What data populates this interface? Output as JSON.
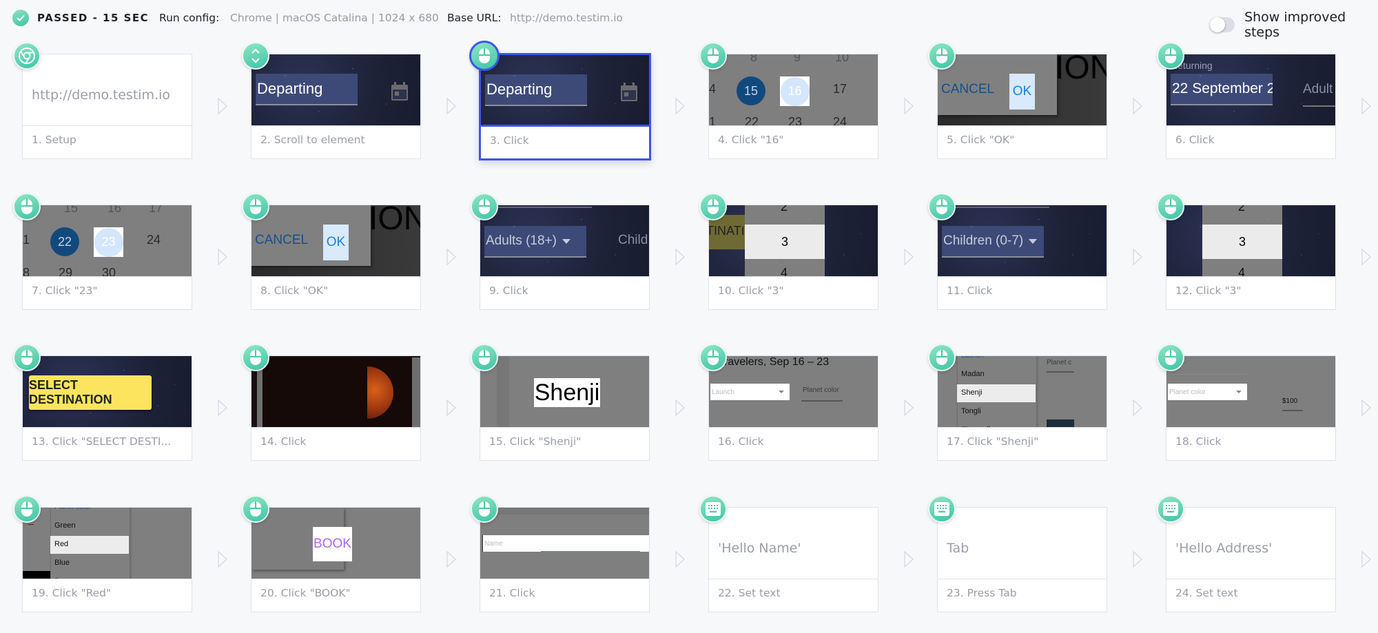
{
  "header": {
    "status": "PASSED - 15 SEC",
    "status_icon": "check-icon",
    "run_config_label": "Run config:",
    "run_config_value": "Chrome | macOS Catalina | 1024 x 680",
    "base_url_label": "Base URL:",
    "base_url_value": "http://demo.testim.io",
    "toggle_label": "Show improved steps",
    "toggle_on": false
  },
  "colors": {
    "accent_selected": "#3d54f0",
    "badge_green": "#3ec4a6",
    "caption_gray": "#9b9dab",
    "background": "#f7f8fa"
  },
  "steps": [
    {
      "caption": "1. Setup",
      "icon": "chrome-icon",
      "thumb": {
        "kind": "text",
        "text": "http://demo.testim.io"
      }
    },
    {
      "caption": "2. Scroll to element",
      "icon": "scroll-icon",
      "thumb": {
        "kind": "departing",
        "text": "Departing"
      }
    },
    {
      "caption": "3. Click",
      "icon": "mouse-icon",
      "selected": true,
      "thumb": {
        "kind": "departing",
        "text": "Departing"
      }
    },
    {
      "caption": "4. Click \"16\"",
      "icon": "mouse-icon",
      "thumb": {
        "kind": "calendar",
        "top": [
          "8",
          "9",
          "10"
        ],
        "left_edge": "4",
        "selected": "15",
        "target": "16",
        "next": "17",
        "bottom": [
          "1",
          "22",
          "23",
          "24"
        ]
      }
    },
    {
      "caption": "5. Click \"OK\"",
      "icon": "mouse-icon",
      "thumb": {
        "kind": "dialog",
        "cancel": "CANCEL",
        "ok": "OK",
        "bg_text": "ION"
      }
    },
    {
      "caption": "6. Click",
      "icon": "mouse-icon",
      "thumb": {
        "kind": "returning",
        "label": "Returning",
        "text": "22 September 2",
        "side": "Adult"
      }
    },
    {
      "caption": "7. Click \"23\"",
      "icon": "mouse-icon",
      "thumb": {
        "kind": "calendar",
        "top": [
          "15",
          "16",
          "17"
        ],
        "left_edge": "1",
        "selected": "22",
        "target": "23",
        "next": "24",
        "bottom": [
          "8",
          "29",
          "30",
          ""
        ]
      }
    },
    {
      "caption": "8. Click \"OK\"",
      "icon": "mouse-icon",
      "thumb": {
        "kind": "dialog",
        "cancel": "CANCEL",
        "ok": "OK",
        "bg_text": "ION"
      }
    },
    {
      "caption": "9. Click",
      "icon": "mouse-icon",
      "thumb": {
        "kind": "dropdown-field",
        "text": "Adults (18+)",
        "side": "Child"
      }
    },
    {
      "caption": "10. Click \"3\"",
      "icon": "mouse-icon",
      "thumb": {
        "kind": "picker",
        "above": "2",
        "value": "3",
        "below": "4",
        "side": "TINATI"
      }
    },
    {
      "caption": "11. Click",
      "icon": "mouse-icon",
      "thumb": {
        "kind": "dropdown-field",
        "text": "Children (0-7)",
        "side": ""
      }
    },
    {
      "caption": "12. Click \"3\"",
      "icon": "mouse-icon",
      "thumb": {
        "kind": "picker",
        "above": "2",
        "value": "3",
        "below": "4",
        "side": ""
      }
    },
    {
      "caption": "13. Click \"SELECT DESTI...",
      "icon": "mouse-icon",
      "thumb": {
        "kind": "yellow-button",
        "text": "SELECT DESTINATION"
      }
    },
    {
      "caption": "14. Click",
      "icon": "mouse-icon",
      "thumb": {
        "kind": "moon"
      }
    },
    {
      "caption": "15. Click \"Shenji\"",
      "icon": "mouse-icon",
      "thumb": {
        "kind": "big-word",
        "text": "Shenji"
      }
    },
    {
      "caption": "16. Click",
      "icon": "mouse-icon",
      "thumb": {
        "kind": "travelers",
        "title": "ravelers, Sep 16 – 23",
        "select": "Launch",
        "side": "Planet color"
      }
    },
    {
      "caption": "17. Click \"Shenji\"",
      "icon": "mouse-icon",
      "thumb": {
        "kind": "list",
        "header": "Launch",
        "items": [
          "Madan",
          "Shenji",
          "Tongli",
          "Flagstaff"
        ],
        "selected_index": 1,
        "side": "Planet c"
      }
    },
    {
      "caption": "18. Click",
      "icon": "mouse-icon",
      "thumb": {
        "kind": "planet-select",
        "select": "Planet color",
        "side": "$100"
      }
    },
    {
      "caption": "19. Click \"Red\"",
      "icon": "mouse-icon",
      "thumb": {
        "kind": "list",
        "header": "Planet color",
        "items": [
          "Green",
          "Red",
          "Blue",
          "Brown"
        ],
        "selected_index": 1,
        "side": ""
      }
    },
    {
      "caption": "20. Click \"BOOK\"",
      "icon": "mouse-icon",
      "thumb": {
        "kind": "book",
        "text": "BOOK"
      }
    },
    {
      "caption": "21. Click",
      "icon": "mouse-icon",
      "thumb": {
        "kind": "name-input",
        "placeholder": "Name"
      }
    },
    {
      "caption": "22. Set text",
      "icon": "keyboard-icon",
      "thumb": {
        "kind": "text",
        "text": "'Hello Name'"
      }
    },
    {
      "caption": "23. Press Tab",
      "icon": "keyboard-icon",
      "thumb": {
        "kind": "text",
        "text": "Tab"
      }
    },
    {
      "caption": "24. Set text",
      "icon": "keyboard-icon",
      "thumb": {
        "kind": "text",
        "text": "'Hello Address'"
      }
    }
  ]
}
